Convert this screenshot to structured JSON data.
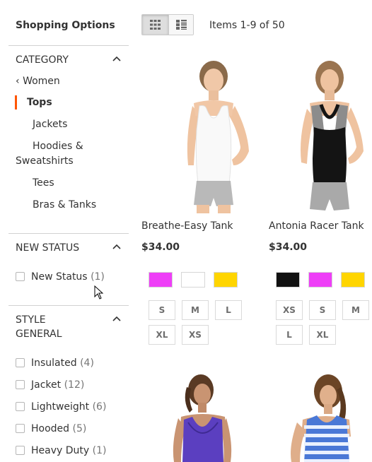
{
  "sidebar": {
    "title": "Shopping Options",
    "category": {
      "heading": "CATEGORY",
      "back_label": "Women",
      "current": "Tops",
      "items": [
        "Jackets",
        "Hoodies &",
        "Sweatshirts",
        "Tees",
        "Bras & Tanks"
      ]
    },
    "new_status": {
      "heading": "NEW STATUS",
      "option": {
        "label": "New Status",
        "count": "(1)"
      }
    },
    "style": {
      "heading_line1": "STYLE",
      "heading_line2": "GENERAL",
      "options": [
        {
          "label": "Insulated",
          "count": "(4)"
        },
        {
          "label": "Jacket",
          "count": "(12)"
        },
        {
          "label": "Lightweight",
          "count": "(6)"
        },
        {
          "label": "Hooded",
          "count": "(5)"
        },
        {
          "label": "Heavy Duty",
          "count": "(1)"
        }
      ]
    }
  },
  "toolbar": {
    "items_label": "Items 1-9 of 50",
    "view_modes": [
      "grid-view-icon",
      "list-view-icon"
    ],
    "active_mode": "grid"
  },
  "products": [
    {
      "name": "Breathe-Easy Tank",
      "price": "$34.00",
      "swatches": [
        "#ee3ef7",
        "#ffffff",
        "#ffd500"
      ],
      "sizes": [
        "S",
        "M",
        "L",
        "XL",
        "XS"
      ]
    },
    {
      "name": "Antonia Racer Tank",
      "price": "$34.00",
      "swatches": [
        "#111111",
        "#ee3ef7",
        "#ffd500"
      ],
      "sizes": [
        "XS",
        "S",
        "M",
        "L",
        "XL"
      ]
    }
  ],
  "colors": {
    "accent": "#ff5501",
    "separator": "#d1d1d1",
    "text": "#333333"
  }
}
